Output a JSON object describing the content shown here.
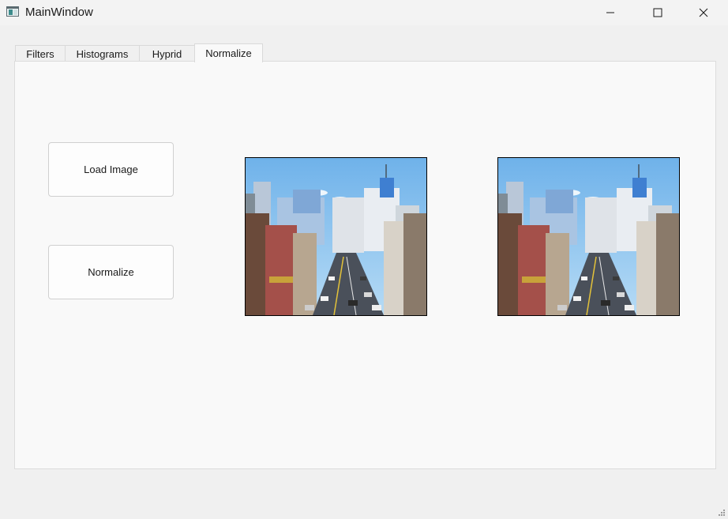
{
  "window": {
    "title": "MainWindow",
    "icon": "app-window-icon",
    "controls": [
      "minimize-icon",
      "maximize-icon",
      "close-icon"
    ]
  },
  "tabs": [
    {
      "label": "Filters",
      "active": false
    },
    {
      "label": "Histograms",
      "active": false
    },
    {
      "label": "Hyprid",
      "active": false
    },
    {
      "label": "Normalize",
      "active": true
    }
  ],
  "buttons": {
    "load_label": "Load Image",
    "normalize_label": "Normalize"
  },
  "images": {
    "input": "city-street-photo",
    "output": "city-street-photo"
  },
  "colors": {
    "window_bg": "#f0f0f0",
    "panel_bg": "#f9f9f9",
    "sky": "#8fc3ee"
  }
}
